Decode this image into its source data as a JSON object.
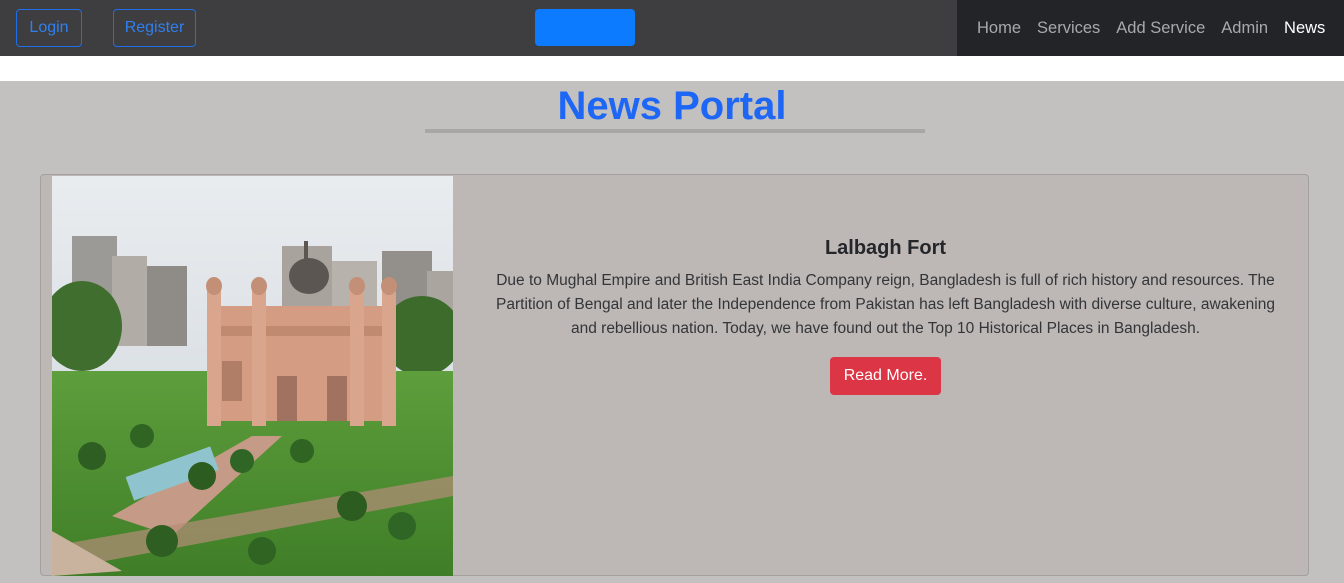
{
  "header": {
    "login_label": "Login",
    "register_label": "Register",
    "nav": [
      {
        "label": "Home"
      },
      {
        "label": "Services"
      },
      {
        "label": "Add Service"
      },
      {
        "label": "Admin"
      },
      {
        "label": "News"
      }
    ]
  },
  "main": {
    "title": "News Portal",
    "card": {
      "heading": "Lalbagh Fort",
      "body": "Due to Mughal Empire and British East India Company reign, Bangladesh is full of rich history and resources. The Partition of Bengal and later the Independence from Pakistan has left Bangladesh with diverse culture, awakening and rebellious nation. Today, we have found out the Top 10 Historical Places in Bangladesh.",
      "button_label": "Read More."
    }
  },
  "colors": {
    "accent": "#1e66f5",
    "danger": "#dc3545",
    "navbar": "#222427"
  }
}
